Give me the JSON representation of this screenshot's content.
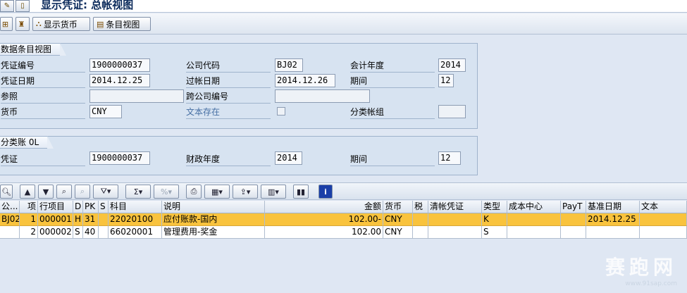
{
  "titlebar": {
    "title": "显示凭证: 总帐视图"
  },
  "app_toolbar": {
    "display_currency": "显示货币",
    "entry_view": "条目视图"
  },
  "header_group": {
    "title": "数据条目视图",
    "doc_no_label": "凭证编号",
    "doc_no": "1900000037",
    "company_label": "公司代码",
    "company": "BJ02",
    "fiscal_year_label": "会计年度",
    "fiscal_year": "2014",
    "doc_date_label": "凭证日期",
    "doc_date": "2014.12.25",
    "posting_date_label": "过帐日期",
    "posting_date": "2014.12.26",
    "period_label": "期间",
    "period": "12",
    "reference_label": "参照",
    "cross_company_label": "跨公司编号",
    "currency_label": "货币",
    "currency": "CNY",
    "text_exists_label": "文本存在",
    "ledger_group_label": "分类帐组"
  },
  "ledger_group": {
    "title": "分类账 0L",
    "doc_label": "凭证",
    "doc": "1900000037",
    "fiscal_year_label": "财政年度",
    "fiscal_year": "2014",
    "period_label": "期间",
    "period": "12"
  },
  "table": {
    "columns": [
      "公...",
      "项",
      "行项目",
      "D",
      "PK",
      "S",
      "科目",
      "说明",
      "金额",
      "货币",
      "税",
      "清帐凭证",
      "类型",
      "成本中心",
      "PayT",
      "基准日期",
      "文本"
    ],
    "rows": [
      [
        "BJ02",
        "1",
        "000001",
        "H",
        "31",
        "",
        "22020100",
        "应付账款-国内",
        "102.00-",
        "CNY",
        "",
        "",
        "K",
        "",
        "",
        "2014.12.25",
        ""
      ],
      [
        "",
        "2",
        "000002",
        "S",
        "40",
        "",
        "66020001",
        "管理费用-奖金",
        "102.00",
        "CNY",
        "",
        "",
        "S",
        "",
        "",
        "",
        ""
      ]
    ]
  },
  "watermark": {
    "text": "赛跑网",
    "url": "www.91sap.com"
  }
}
